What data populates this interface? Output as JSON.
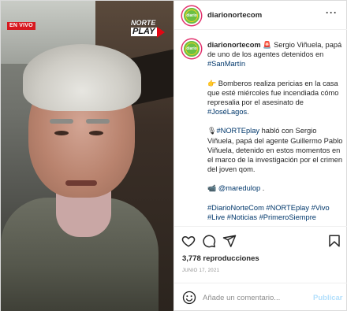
{
  "video": {
    "live_label": "EN VIVO",
    "logo_line1": "NORTE",
    "logo_line2": "PLAY"
  },
  "header": {
    "username": "diarionortecom",
    "more_label": "···",
    "avatar_text": "diario"
  },
  "caption": {
    "username": "diarionortecom",
    "p1_text": " Sergio Viñuela, papá de uno de los agentes detenidos en ",
    "p1_tag": "#SanMartín",
    "p2_text": " Bomberos realiza pericias en la casa que esté miércoles fue incendiada cómo represalia por el asesinato de ",
    "p2_tag": "#JoséLagos",
    "p2_end": ".",
    "p3_tag": "#NORTEplay",
    "p3_text": " habló con Sergio Viñuela, papá del agente Guillermo Pablo Viñuela, detenido en estos momentos en el marco de la investigación por el crimen del joven qom.",
    "p4_tag": "@maredulop",
    "p4_end": " .",
    "p5_tags": "#DiarioNorteCom #NORTEplay #Vivo #Live #Noticias #PrimeroSiempre",
    "emoji": {
      "siren": "🚨",
      "pointing": "👉",
      "mic": "🎙",
      "camera": "📹"
    }
  },
  "stats": {
    "views": "3,778 reproducciones",
    "date": "JUNIO 17, 2021"
  },
  "comment": {
    "placeholder": "Añade un comentario...",
    "post_label": "Publicar"
  },
  "colors": {
    "link": "#00376b",
    "muted": "#8e8e8e",
    "post_disabled": "#b2dffc",
    "live_red": "#d71920",
    "avatar_green": "#6abf45"
  },
  "icons": [
    "heart-icon",
    "comment-icon",
    "share-icon",
    "bookmark-icon",
    "emoji-icon",
    "more-icon"
  ]
}
